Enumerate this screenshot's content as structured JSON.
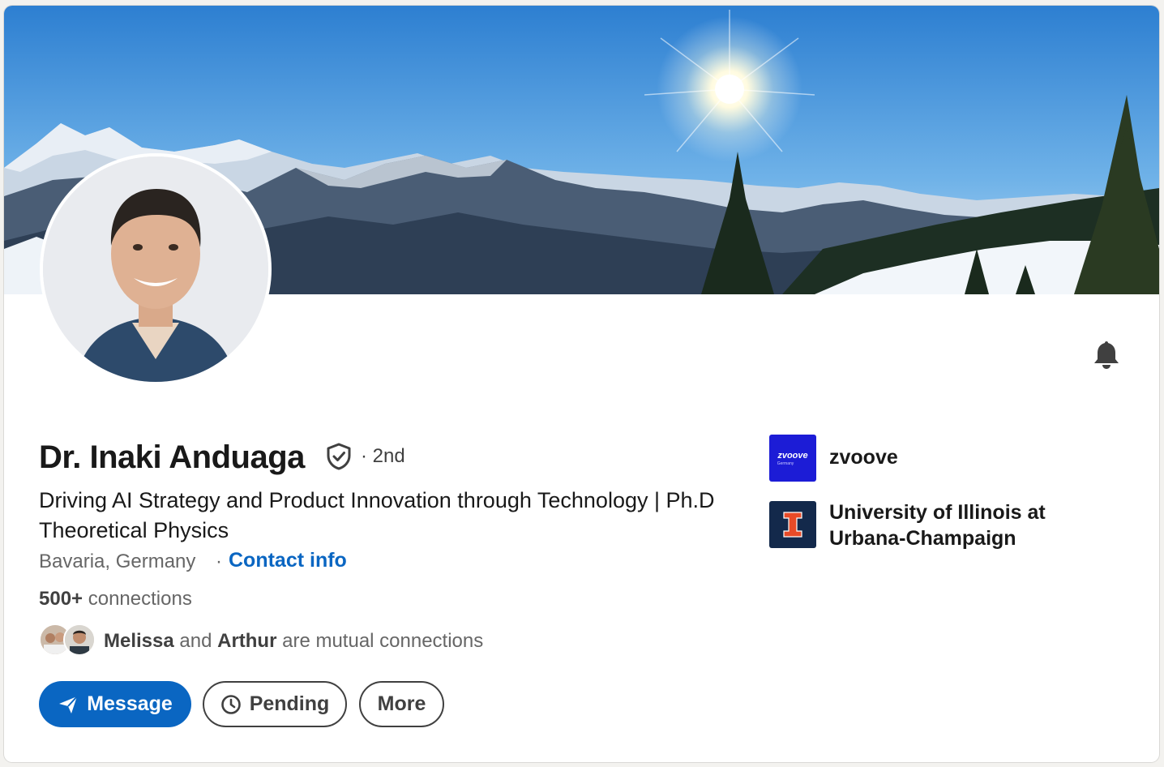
{
  "profile": {
    "name": "Dr. Inaki Anduaga",
    "degree": "· 2nd",
    "headline": "Driving AI Strategy and Product Innovation through Technology | Ph.D Theoretical Physics",
    "location": "Bavaria, Germany",
    "location_sep": "·",
    "contact_link": "Contact info",
    "connections_count": "500+",
    "connections_label": "connections"
  },
  "mutual": {
    "first": "Melissa",
    "and": "and",
    "second": "Arthur",
    "suffix": "are mutual connections"
  },
  "actions": {
    "message": "Message",
    "pending": "Pending",
    "more": "More"
  },
  "orgs": [
    {
      "name": "zvoove",
      "logo_text": "zvoove",
      "logo_sub": "Germany",
      "color": "#1c1cd6"
    },
    {
      "name": "University of Illinois at Urbana-Champaign",
      "logo_text": "I",
      "color": "#13294b",
      "accent": "#e84a27"
    }
  ],
  "colors": {
    "primary": "#0a66c2",
    "text": "#191919",
    "muted": "#666666"
  },
  "icons": [
    "bell-icon",
    "verified-shield-icon",
    "send-icon",
    "clock-icon"
  ]
}
